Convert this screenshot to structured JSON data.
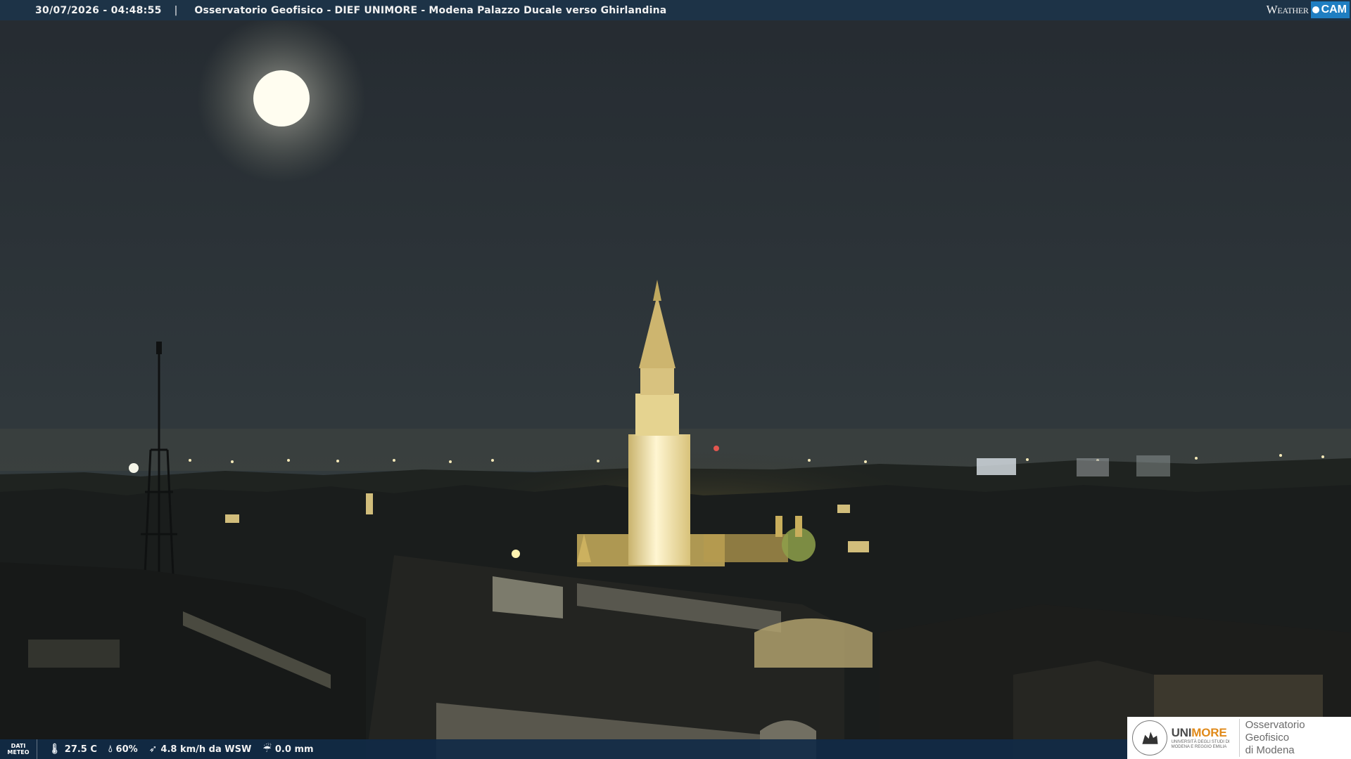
{
  "header": {
    "timestamp": "30/07/2026 - 04:48:55",
    "separator": "|",
    "title": "Osservatorio Geofisico - DIEF UNIMORE - Modena Palazzo Ducale verso Ghirlandina"
  },
  "brand": {
    "weather": "Weather",
    "cam": "CAM"
  },
  "meteo": {
    "label_line1": "DATI",
    "label_line2": "METEO",
    "temperature": "27.5 C",
    "humidity": "60%",
    "wind": "4.8 km/h da WSW",
    "rain": "0.0 mm",
    "icons": {
      "temperature": "thermometer-icon",
      "humidity": "drop-icon",
      "wind": "wind-icon",
      "rain": "rain-icon"
    }
  },
  "logo": {
    "uni_grey": "UNI",
    "uni_orange": "MORE",
    "uni_sub": "UNIVERSITÀ DEGLI STUDI DI MODENA E REGGIO EMILIA",
    "observatory_line1": "Osservatorio Geofisico",
    "observatory_line2": "di Modena"
  },
  "colors": {
    "topbar": "#1d3347",
    "bottombar": "#112a46",
    "cam_accent": "#1f7ec2",
    "logo_orange": "#e08a1a"
  }
}
